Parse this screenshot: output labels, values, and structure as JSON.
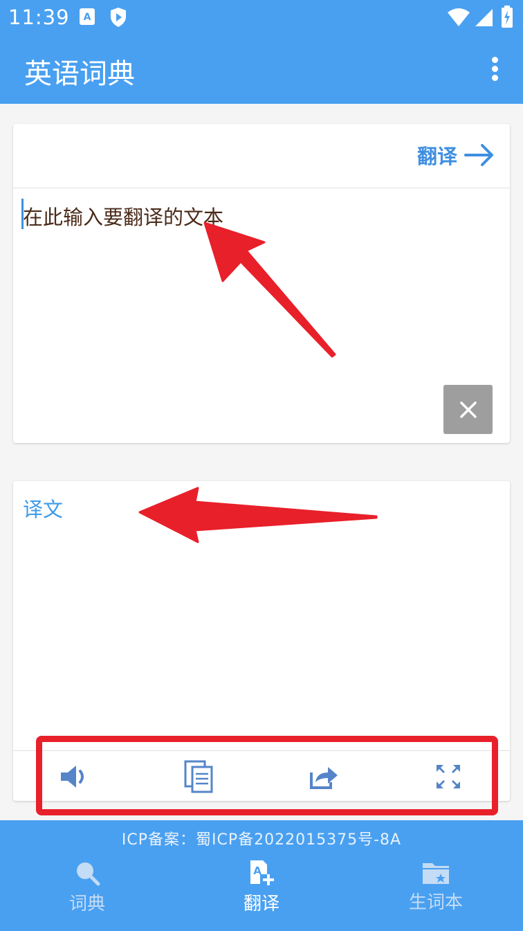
{
  "status_bar": {
    "time": "11:39"
  },
  "app_bar": {
    "title": "英语词典"
  },
  "input_card": {
    "translate_label": "翻译",
    "input_placeholder": "在此输入要翻译的文本"
  },
  "output_card": {
    "label": "译文"
  },
  "footer": {
    "icp": "ICP备案：蜀ICP备2022015375号-8A"
  },
  "bottom_nav": {
    "items": [
      {
        "label": "词典",
        "icon": "search-icon",
        "active": false
      },
      {
        "label": "翻译",
        "icon": "translate-icon",
        "active": true
      },
      {
        "label": "生词本",
        "icon": "folder-star-icon",
        "active": false
      }
    ]
  },
  "colors": {
    "primary": "#4aa0f0",
    "accent_text": "#3f8fe0",
    "clear_button": "#9e9e9e",
    "annotation": "#e8202a"
  }
}
